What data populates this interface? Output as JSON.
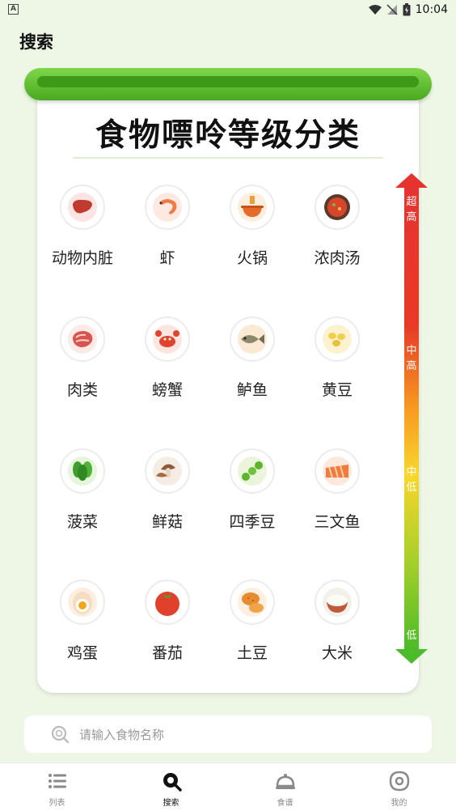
{
  "status_bar": {
    "time": "10:04",
    "app_badge": "A"
  },
  "header": {
    "title": "搜索"
  },
  "card": {
    "title": "食物嘌呤等级分类",
    "foods": [
      {
        "name": "动物内脏",
        "icon": "liver-icon"
      },
      {
        "name": "虾",
        "icon": "shrimp-icon"
      },
      {
        "name": "火锅",
        "icon": "hotpot-icon"
      },
      {
        "name": "浓肉汤",
        "icon": "meat-soup-icon"
      },
      {
        "name": "肉类",
        "icon": "meat-icon"
      },
      {
        "name": "螃蟹",
        "icon": "crab-icon"
      },
      {
        "name": "鲈鱼",
        "icon": "perch-icon"
      },
      {
        "name": "黄豆",
        "icon": "soybean-icon"
      },
      {
        "name": "菠菜",
        "icon": "spinach-icon"
      },
      {
        "name": "鲜菇",
        "icon": "mushroom-icon"
      },
      {
        "name": "四季豆",
        "icon": "green-bean-icon"
      },
      {
        "name": "三文鱼",
        "icon": "salmon-icon"
      },
      {
        "name": "鸡蛋",
        "icon": "egg-icon"
      },
      {
        "name": "番茄",
        "icon": "tomato-icon"
      },
      {
        "name": "土豆",
        "icon": "potato-icon"
      },
      {
        "name": "大米",
        "icon": "rice-icon"
      }
    ]
  },
  "scale": {
    "levels": [
      "超高",
      "中高",
      "中低",
      "低"
    ],
    "colors": [
      "#e63330",
      "#f79b22",
      "#f9d62a",
      "#4bbb2a"
    ]
  },
  "search": {
    "placeholder": "请输入食物名称"
  },
  "tabs": [
    {
      "label": "列表",
      "icon": "list-icon",
      "active": false
    },
    {
      "label": "搜索",
      "icon": "search-icon",
      "active": true
    },
    {
      "label": "食谱",
      "icon": "cloche-icon",
      "active": false
    },
    {
      "label": "我的",
      "icon": "profile-icon",
      "active": false
    }
  ],
  "colors": {
    "accent_green": "#4aa920",
    "background": "#eef6e6"
  }
}
